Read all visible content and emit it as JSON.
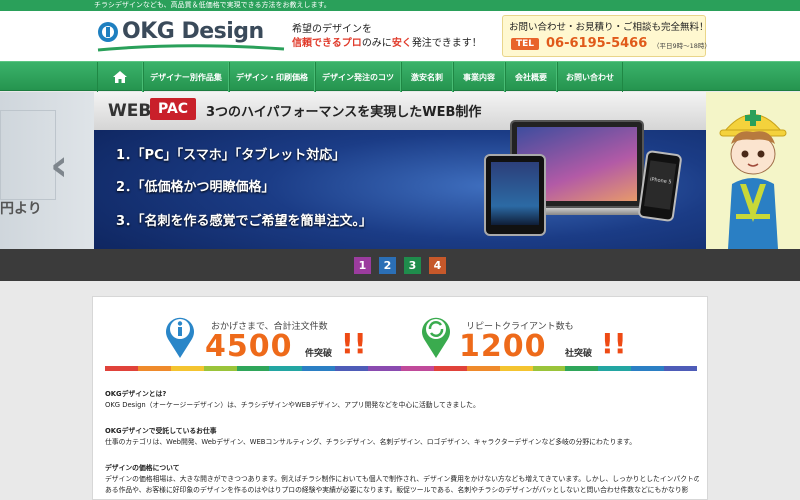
{
  "topbar": {
    "text": "チラシデザインなども、高品質＆低価格で実現できる方法をお教えします。"
  },
  "header": {
    "logo_text": "OKG Design",
    "tagline_line1": "希望のデザインを",
    "tagline_red": "信頼できるプロ",
    "tagline_mid": "のみに",
    "tagline_cheap": "安く",
    "tagline_end": "発注できます！",
    "contact_title": "お問い合わせ・お見積り・ご相談も完全無料！",
    "tel_label": "TEL",
    "tel_number": "06-6195-5466",
    "tel_hours": "（平日9時～18時）"
  },
  "nav": {
    "items": [
      {
        "label": ""
      },
      {
        "label": "デザイナー別作品集"
      },
      {
        "label": "デザイン・印刷価格"
      },
      {
        "label": "デザイン発注のコツ"
      },
      {
        "label": "激安名刺"
      },
      {
        "label": "事業内容"
      },
      {
        "label": "会社概要"
      },
      {
        "label": "お問い合わせ"
      }
    ]
  },
  "slider": {
    "left_yen": "円より",
    "web": "WEB",
    "pac": "PAC",
    "headline": "3つのハイパフォーマンスを実現したWEB制作",
    "point1": "1．「PC」「スマホ」「タブレット対応」",
    "point2": "2．「低価格かつ明瞭価格」",
    "point3": "3．「名刺を作る感覚でご希望を簡単注文。」",
    "iphone_label": "iPhone 5"
  },
  "pager": {
    "items": [
      "1",
      "2",
      "3",
      "4"
    ],
    "colors": [
      "#9b3c9e",
      "#2b6fb6",
      "#1f8c4c",
      "#c6582a"
    ]
  },
  "stats": {
    "orders_label": "おかげさまで、合計注文件数",
    "orders_value": "4500",
    "orders_suffix": "件突破",
    "clients_label": "リピートクライアント数も",
    "clients_value": "1200",
    "clients_suffix": "社突破",
    "bang": "!!"
  },
  "rainbow_colors": [
    "#e0423a",
    "#ef8a2b",
    "#f4c430",
    "#9ac43a",
    "#2fa65a",
    "#23a6a2",
    "#2b7fc4",
    "#4e5cb8",
    "#8a4bb0",
    "#c04a9a",
    "#e0423a",
    "#ef8a2b",
    "#f4c430",
    "#9ac43a",
    "#2fa65a",
    "#23a6a2",
    "#2b7fc4",
    "#4e5cb8"
  ],
  "content": {
    "h1": "OKGデザインとは?",
    "p1": "OKG Design（オーケージーデザイン）は、チラシデザインやWEBデザイン、アプリ開発などを中心に活動してきました。",
    "h2": "OKGデザインで受託しているお仕事",
    "p2": "仕事のカテゴリは、Web開発、Webデザイン、WEBコンサルティング、チラシデザイン、名刺デザイン、ロゴデザイン、キャラクターデザインなど多岐の分野にわたります。",
    "h3": "デザインの価格について",
    "p3a": "デザインの価格相場は、大きな開きができつつあります。例えばチラシ制作においても個人で制作され、デザイン費用をかけない方なども増えてきています。しかし、しっかりとしたインパクトの",
    "p3b": "ある作品や、お客様に好印象のデザインを作るのはやはりプロの経験や実績が必要になります。販促ツールである、名刺やチラシのデザインがパッとしないと問い合わせ件数などにもかなり影"
  }
}
